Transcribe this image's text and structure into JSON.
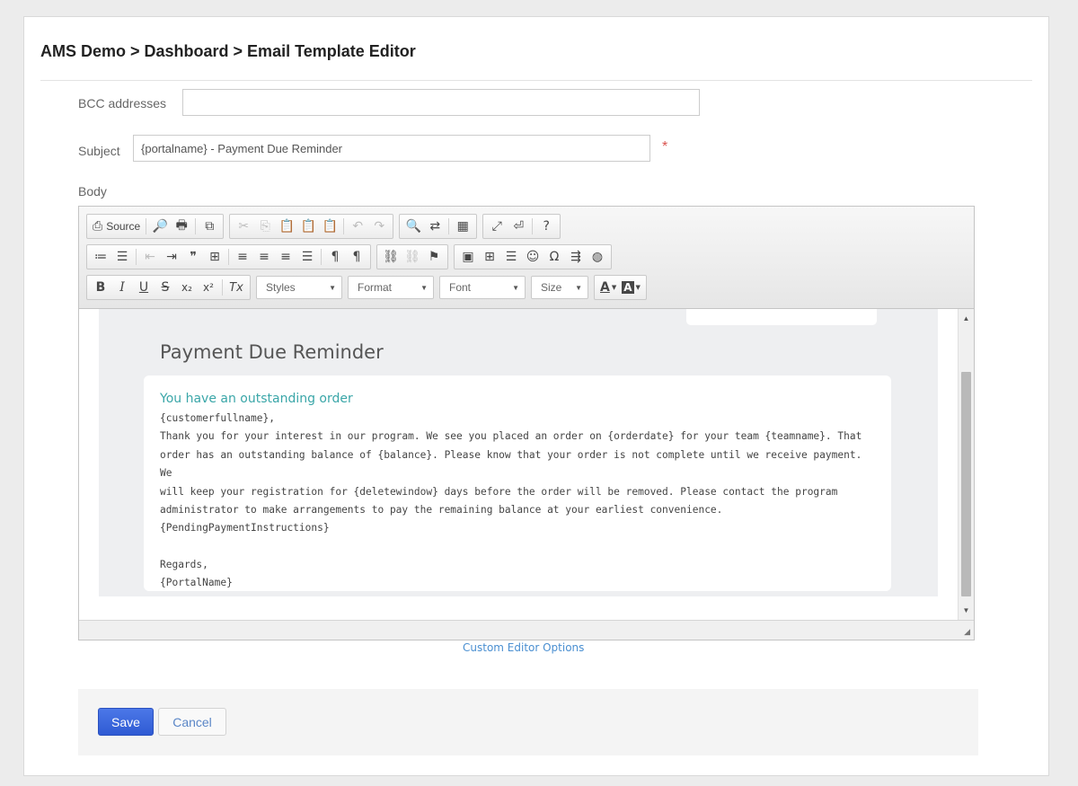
{
  "breadcrumb": "AMS Demo > Dashboard > Email Template Editor",
  "bcc": {
    "label": "BCC addresses",
    "value": ""
  },
  "subject": {
    "label": "Subject",
    "value": "{portalname} - Payment Due Reminder",
    "required_mark": "*"
  },
  "body": {
    "label": "Body"
  },
  "toolbar": {
    "source_label": "Source",
    "styles_label": "Styles",
    "format_label": "Format",
    "font_label": "Font",
    "size_label": "Size",
    "text_color_glyph": "A",
    "bg_color_glyph": "A",
    "row1": [
      "⎙",
      "🔍",
      "🖶",
      "⧉",
      "✂",
      "⎘",
      "📋",
      "📋",
      "📋",
      "↶",
      "↷",
      "🔍",
      "⇄",
      "▦",
      "⤢",
      "⏎",
      "?"
    ],
    "row3": [
      "B",
      "I",
      "U",
      "S",
      "x₂",
      "x²",
      "Tx"
    ]
  },
  "email": {
    "title": "Payment Due Reminder",
    "heading": "You have an outstanding order",
    "lines": [
      "{customerfullname},",
      "Thank you for your interest in our program. We see you placed an order on {orderdate} for your team {teamname}. That",
      "order has an outstanding balance of {balance}. Please know that your order is not complete until we receive payment. We",
      "will keep your registration for {deletewindow} days before the order will be removed. Please contact the program",
      "administrator to make arrangements to pay the remaining balance at your earliest convenience.",
      "{PendingPaymentInstructions}",
      "",
      "Regards,",
      "{PortalName}"
    ]
  },
  "custom_editor_options": "Custom Editor Options",
  "actions": {
    "save": "Save",
    "cancel": "Cancel"
  },
  "colors": {
    "accent": "#3a66e0",
    "heading_teal": "#3aa6a8",
    "link": "#4a8fd1"
  }
}
